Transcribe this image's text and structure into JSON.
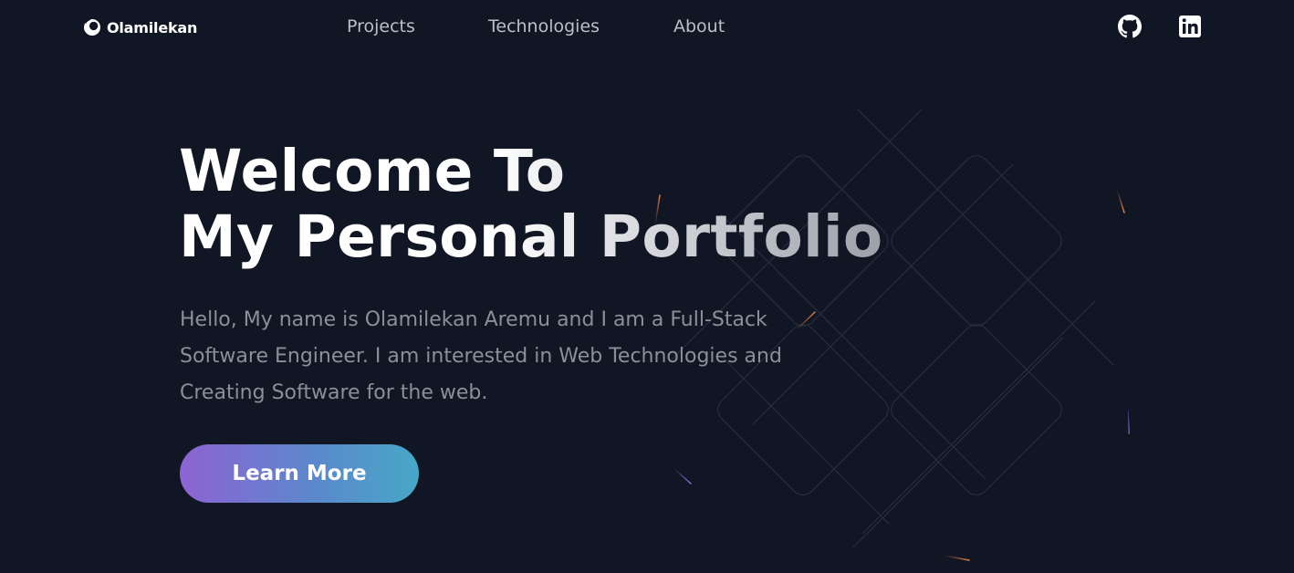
{
  "nav": {
    "logo_text": "Olamilekan",
    "links": [
      "Projects",
      "Technologies",
      "About"
    ]
  },
  "social": [
    {
      "icon": "github-icon",
      "label": "GitHub"
    },
    {
      "icon": "linkedin-icon",
      "label": "LinkedIn"
    }
  ],
  "hero": {
    "title_line_1": "Welcome To",
    "title_line_2": "My Personal Portfolio",
    "description": "Hello, My name is Olamilekan Aremu and I am a Full-Stack Software Engineer. I am interested in Web Technologies and Creating Software for the web.",
    "cta_label": "Learn More"
  },
  "colors": {
    "background": "#111624",
    "nav_text": "#bdbfc5",
    "body_text": "#8b8f99",
    "button_gradient_start": "#8e63d3",
    "button_gradient_end": "#47a8c7"
  }
}
